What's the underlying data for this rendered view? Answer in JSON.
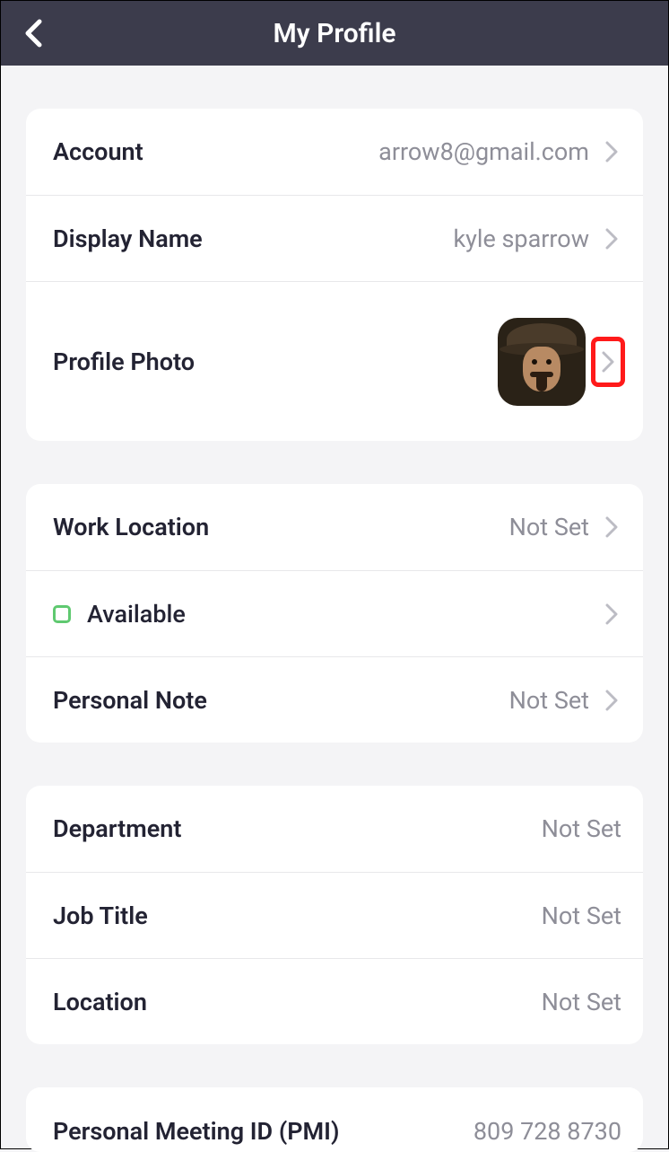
{
  "header": {
    "title": "My Profile"
  },
  "section1": {
    "account": {
      "label": "Account",
      "value": "arrow8@gmail.com"
    },
    "displayName": {
      "label": "Display Name",
      "value": "kyle sparrow"
    },
    "profilePhoto": {
      "label": "Profile Photo"
    }
  },
  "section2": {
    "workLocation": {
      "label": "Work Location",
      "value": "Not Set"
    },
    "status": {
      "label": "Available"
    },
    "personalNote": {
      "label": "Personal Note",
      "value": "Not Set"
    }
  },
  "section3": {
    "department": {
      "label": "Department",
      "value": "Not Set"
    },
    "jobTitle": {
      "label": "Job Title",
      "value": "Not Set"
    },
    "location": {
      "label": "Location",
      "value": "Not Set"
    }
  },
  "section4": {
    "pmi": {
      "label": "Personal Meeting ID (PMI)",
      "value": "809 728 8730"
    }
  }
}
